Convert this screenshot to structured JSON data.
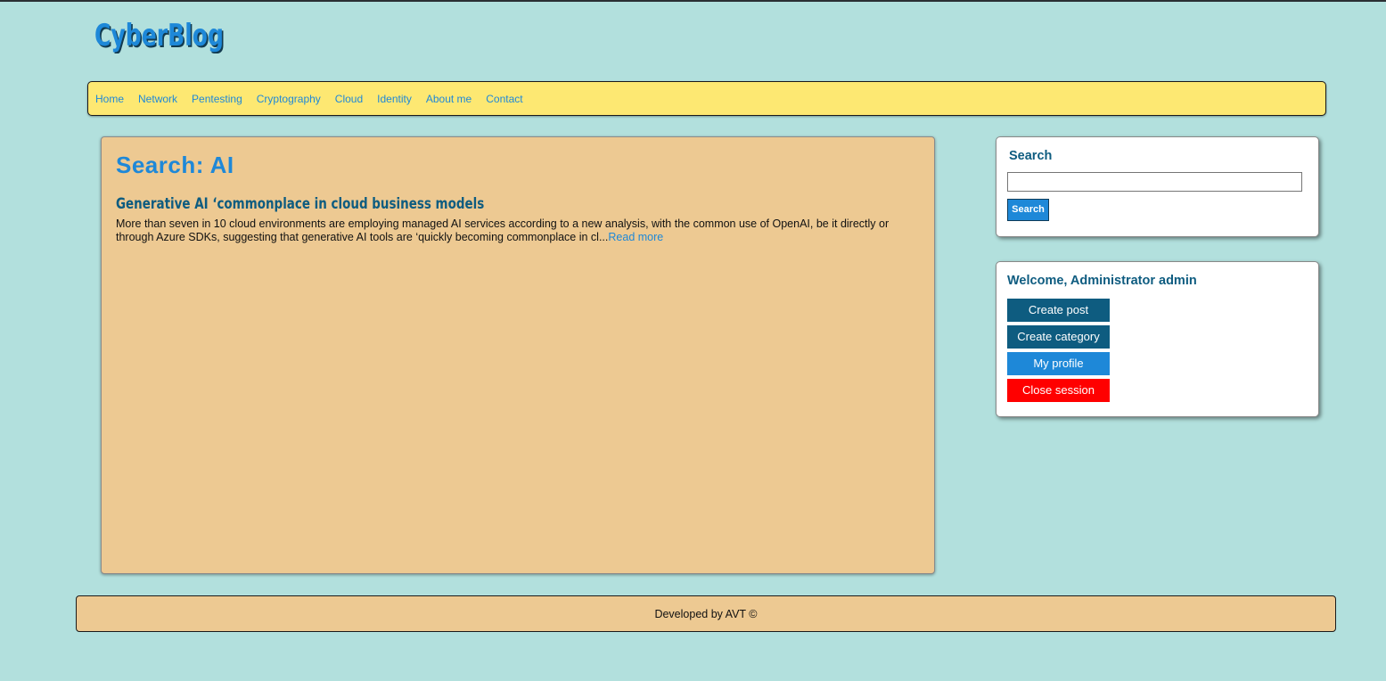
{
  "site": {
    "logo": "CyberBlog"
  },
  "nav": {
    "items": [
      "Home",
      "Network",
      "Pentesting",
      "Cryptography",
      "Cloud",
      "Identity",
      "About me",
      "Contact"
    ]
  },
  "main": {
    "heading": "Search: AI",
    "posts": [
      {
        "title": "Generative AI ‘commonplace in cloud business models",
        "excerpt": "More than seven in 10 cloud environments are employing managed AI services according to a new analysis, with the common use of OpenAI, be it directly or through Azure SDKs, suggesting that generative AI tools are ‘quickly becoming commonplace in cl...",
        "read_more": "Read more"
      }
    ]
  },
  "search_widget": {
    "title": "Search",
    "input_value": "",
    "button_label": "Search"
  },
  "welcome_widget": {
    "title": "Welcome, Administrator admin",
    "buttons": [
      "Create post",
      "Create category",
      "My profile",
      "Close session"
    ]
  },
  "footer": {
    "text": "Developed by AVT ©"
  },
  "colors": {
    "background": "#b2e0dd",
    "nav_bg": "#fde872",
    "content_bg": "#edc992",
    "accent_blue": "#1e88d8",
    "dark_teal": "#0e5c80",
    "danger_red": "#ff0000"
  }
}
